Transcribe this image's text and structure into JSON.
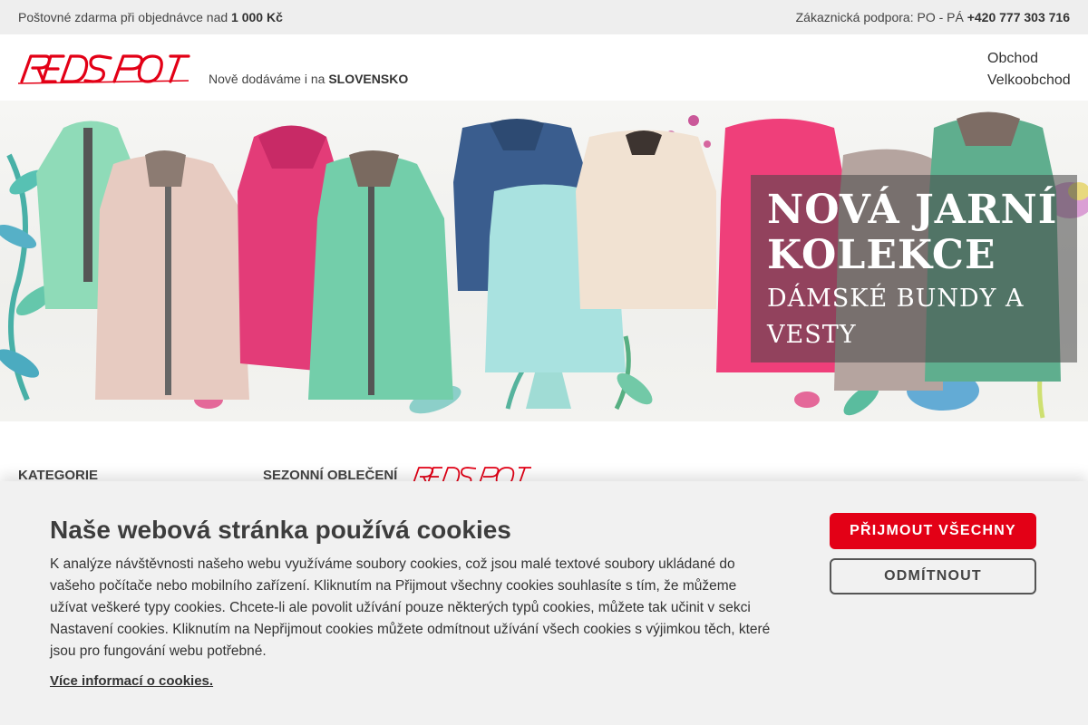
{
  "topbar": {
    "shipping_prefix": "Poštovné zdarma při objednávce nad",
    "shipping_amount": "1 000 Kč",
    "support_prefix": "Zákaznická podpora: PO - PÁ",
    "support_phone": "+420 777 303 716"
  },
  "header": {
    "logo_text": "REDSPOT",
    "tagline_prefix": "Nově dodáváme i na",
    "tagline_country": "SLOVENSKO",
    "nav": [
      "Obchod",
      "Velkoobchod"
    ]
  },
  "hero": {
    "title_line1": "NOVÁ JARNÍ",
    "title_line2": "KOLEKCE",
    "subtitle_line1": "DÁMSKÉ BUNDY A",
    "subtitle_line2": "VESTY"
  },
  "sections": {
    "categories": "KATEGORIE",
    "seasonal": "SEZONNÍ OBLEČENÍ"
  },
  "cookie": {
    "title": "Naše webová stránka používá cookies",
    "text": "K analýze návštěvnosti našeho webu využíváme soubory cookies, což jsou malé textové soubory ukládané do vašeho počítače nebo mobilního zařízení. Kliknutím na Přijmout všechny cookies souhlasíte s tím, že můžeme užívat veškeré typy cookies. Chcete-li ale povolit užívání pouze některých typů cookies, můžete tak učinit v sekci Nastavení cookies. Kliknutím na Nepřijmout cookies můžete odmítnout užívání všech cookies s výjimkou těch, které jsou pro fungování webu potřebné.",
    "more_link": "Více informací o cookies.",
    "accept_label": "PŘIJMOUT VŠECHNY",
    "reject_label": "ODMÍTNOUT"
  },
  "colors": {
    "brand_red": "#e30016",
    "topbar_bg": "#eeeeee",
    "cookie_bg": "#f1f1f1"
  }
}
